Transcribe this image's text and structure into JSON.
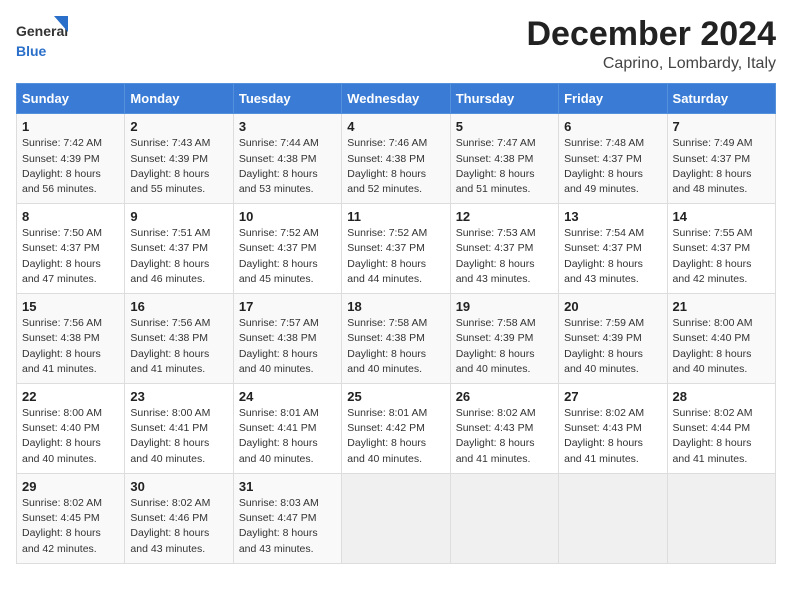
{
  "logo": {
    "general": "General",
    "blue": "Blue"
  },
  "title": "December 2024",
  "subtitle": "Caprino, Lombardy, Italy",
  "weekdays": [
    "Sunday",
    "Monday",
    "Tuesday",
    "Wednesday",
    "Thursday",
    "Friday",
    "Saturday"
  ],
  "weeks": [
    [
      {
        "day": "1",
        "sunrise": "7:42 AM",
        "sunset": "4:39 PM",
        "daylight": "8 hours and 56 minutes."
      },
      {
        "day": "2",
        "sunrise": "7:43 AM",
        "sunset": "4:39 PM",
        "daylight": "8 hours and 55 minutes."
      },
      {
        "day": "3",
        "sunrise": "7:44 AM",
        "sunset": "4:38 PM",
        "daylight": "8 hours and 53 minutes."
      },
      {
        "day": "4",
        "sunrise": "7:46 AM",
        "sunset": "4:38 PM",
        "daylight": "8 hours and 52 minutes."
      },
      {
        "day": "5",
        "sunrise": "7:47 AM",
        "sunset": "4:38 PM",
        "daylight": "8 hours and 51 minutes."
      },
      {
        "day": "6",
        "sunrise": "7:48 AM",
        "sunset": "4:37 PM",
        "daylight": "8 hours and 49 minutes."
      },
      {
        "day": "7",
        "sunrise": "7:49 AM",
        "sunset": "4:37 PM",
        "daylight": "8 hours and 48 minutes."
      }
    ],
    [
      {
        "day": "8",
        "sunrise": "7:50 AM",
        "sunset": "4:37 PM",
        "daylight": "8 hours and 47 minutes."
      },
      {
        "day": "9",
        "sunrise": "7:51 AM",
        "sunset": "4:37 PM",
        "daylight": "8 hours and 46 minutes."
      },
      {
        "day": "10",
        "sunrise": "7:52 AM",
        "sunset": "4:37 PM",
        "daylight": "8 hours and 45 minutes."
      },
      {
        "day": "11",
        "sunrise": "7:52 AM",
        "sunset": "4:37 PM",
        "daylight": "8 hours and 44 minutes."
      },
      {
        "day": "12",
        "sunrise": "7:53 AM",
        "sunset": "4:37 PM",
        "daylight": "8 hours and 43 minutes."
      },
      {
        "day": "13",
        "sunrise": "7:54 AM",
        "sunset": "4:37 PM",
        "daylight": "8 hours and 43 minutes."
      },
      {
        "day": "14",
        "sunrise": "7:55 AM",
        "sunset": "4:37 PM",
        "daylight": "8 hours and 42 minutes."
      }
    ],
    [
      {
        "day": "15",
        "sunrise": "7:56 AM",
        "sunset": "4:38 PM",
        "daylight": "8 hours and 41 minutes."
      },
      {
        "day": "16",
        "sunrise": "7:56 AM",
        "sunset": "4:38 PM",
        "daylight": "8 hours and 41 minutes."
      },
      {
        "day": "17",
        "sunrise": "7:57 AM",
        "sunset": "4:38 PM",
        "daylight": "8 hours and 40 minutes."
      },
      {
        "day": "18",
        "sunrise": "7:58 AM",
        "sunset": "4:38 PM",
        "daylight": "8 hours and 40 minutes."
      },
      {
        "day": "19",
        "sunrise": "7:58 AM",
        "sunset": "4:39 PM",
        "daylight": "8 hours and 40 minutes."
      },
      {
        "day": "20",
        "sunrise": "7:59 AM",
        "sunset": "4:39 PM",
        "daylight": "8 hours and 40 minutes."
      },
      {
        "day": "21",
        "sunrise": "8:00 AM",
        "sunset": "4:40 PM",
        "daylight": "8 hours and 40 minutes."
      }
    ],
    [
      {
        "day": "22",
        "sunrise": "8:00 AM",
        "sunset": "4:40 PM",
        "daylight": "8 hours and 40 minutes."
      },
      {
        "day": "23",
        "sunrise": "8:00 AM",
        "sunset": "4:41 PM",
        "daylight": "8 hours and 40 minutes."
      },
      {
        "day": "24",
        "sunrise": "8:01 AM",
        "sunset": "4:41 PM",
        "daylight": "8 hours and 40 minutes."
      },
      {
        "day": "25",
        "sunrise": "8:01 AM",
        "sunset": "4:42 PM",
        "daylight": "8 hours and 40 minutes."
      },
      {
        "day": "26",
        "sunrise": "8:02 AM",
        "sunset": "4:43 PM",
        "daylight": "8 hours and 41 minutes."
      },
      {
        "day": "27",
        "sunrise": "8:02 AM",
        "sunset": "4:43 PM",
        "daylight": "8 hours and 41 minutes."
      },
      {
        "day": "28",
        "sunrise": "8:02 AM",
        "sunset": "4:44 PM",
        "daylight": "8 hours and 41 minutes."
      }
    ],
    [
      {
        "day": "29",
        "sunrise": "8:02 AM",
        "sunset": "4:45 PM",
        "daylight": "8 hours and 42 minutes."
      },
      {
        "day": "30",
        "sunrise": "8:02 AM",
        "sunset": "4:46 PM",
        "daylight": "8 hours and 43 minutes."
      },
      {
        "day": "31",
        "sunrise": "8:03 AM",
        "sunset": "4:47 PM",
        "daylight": "8 hours and 43 minutes."
      },
      null,
      null,
      null,
      null
    ]
  ]
}
